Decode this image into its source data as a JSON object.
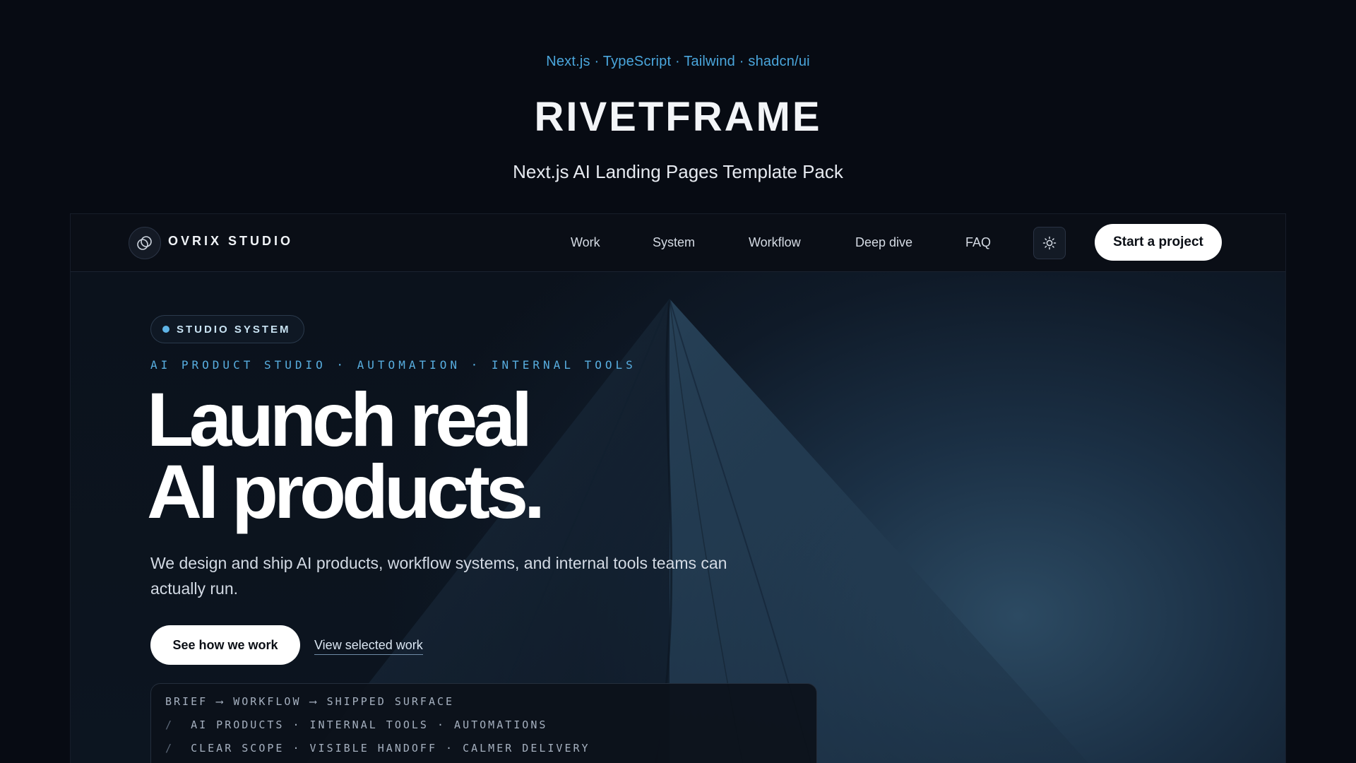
{
  "promo": {
    "stack": "Next.js · TypeScript · Tailwind · shadcn/ui",
    "title": "RIVETFRAME",
    "subtitle": "Next.js AI Landing Pages Template Pack"
  },
  "nav": {
    "logo_text": "OVRIX STUDIO",
    "links": [
      "Work",
      "System",
      "Workflow",
      "Deep dive",
      "FAQ"
    ],
    "theme_icon": "sun-icon",
    "cta_label": "Start a project"
  },
  "hero": {
    "badge": "STUDIO SYSTEM",
    "eyebrow": "AI PRODUCT STUDIO · AUTOMATION · INTERNAL TOOLS",
    "headline_line1": "Launch real",
    "headline_line2": "AI products.",
    "description": "We design and ship AI products, workflow systems, and internal tools teams can actually run.",
    "primary_button": "See how we work",
    "secondary_link": "View selected work",
    "terminal": {
      "line1": "BRIEF ⟶ WORKFLOW ⟶ SHIPPED SURFACE",
      "line2": "AI PRODUCTS · INTERNAL TOOLS · AUTOMATIONS",
      "line3": "CLEAR SCOPE · VISIBLE HANDOFF · CALMER DELIVERY",
      "prefix": "/"
    }
  },
  "colors": {
    "accent": "#4aa6dc",
    "background": "#070b13",
    "cta_bg": "#ffffff"
  }
}
